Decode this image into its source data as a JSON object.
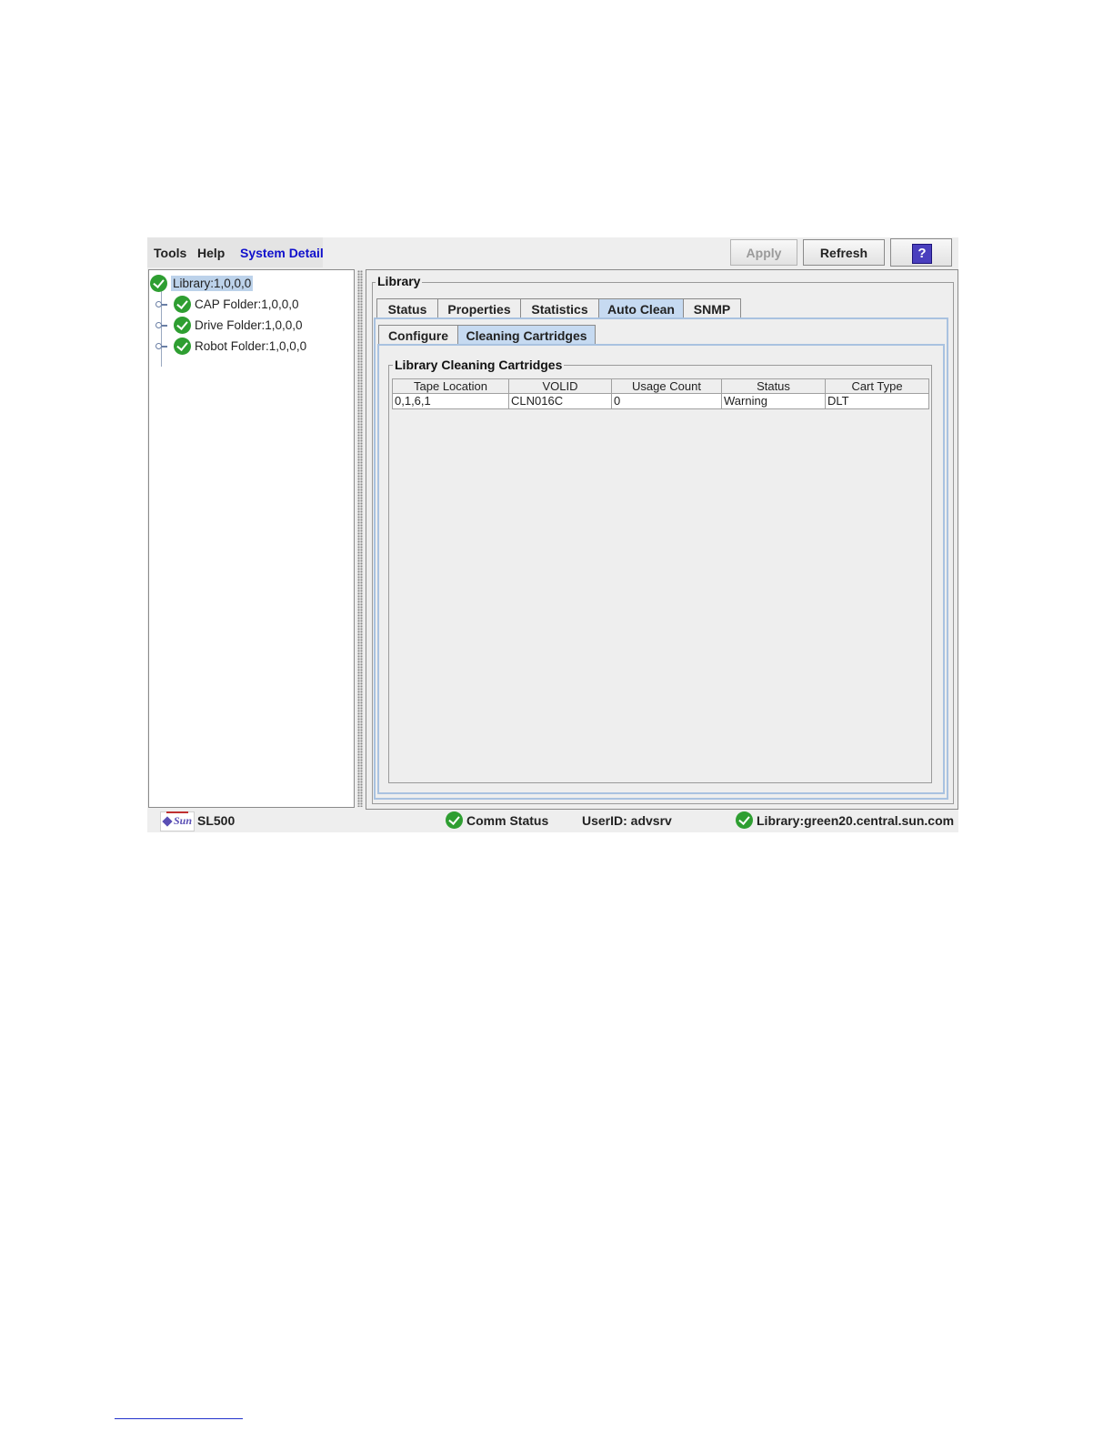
{
  "menubar": {
    "items": [
      "Tools",
      "Help",
      "System Detail"
    ],
    "apply_label": "Apply",
    "refresh_label": "Refresh",
    "help_glyph": "?"
  },
  "tree": {
    "root": "Library:1,0,0,0",
    "children": [
      "CAP Folder:1,0,0,0",
      "Drive Folder:1,0,0,0",
      "Robot Folder:1,0,0,0"
    ]
  },
  "panel": {
    "group_title": "Library",
    "tabs": [
      "Status",
      "Properties",
      "Statistics",
      "Auto Clean",
      "SNMP"
    ],
    "active_tab": "Auto Clean",
    "subtabs": [
      "Configure",
      "Cleaning Cartridges"
    ],
    "active_subtab": "Cleaning Cartridges",
    "section_title": "Library Cleaning Cartridges"
  },
  "table": {
    "columns": [
      "Tape Location",
      "VOLID",
      "Usage Count",
      "Status",
      "Cart Type"
    ],
    "rows": [
      [
        "0,1,6,1",
        "CLN016C",
        "0",
        "Warning",
        "DLT"
      ]
    ]
  },
  "statusbar": {
    "product": "SL500",
    "comm_status": "Comm Status",
    "user": "UserID: advsrv",
    "library": "Library:green20.central.sun.com",
    "logo_text": "Sun"
  },
  "colors": {
    "status_ok": "#2e9e31",
    "active_tab": "#c6daf1",
    "link": "#1010cc"
  }
}
